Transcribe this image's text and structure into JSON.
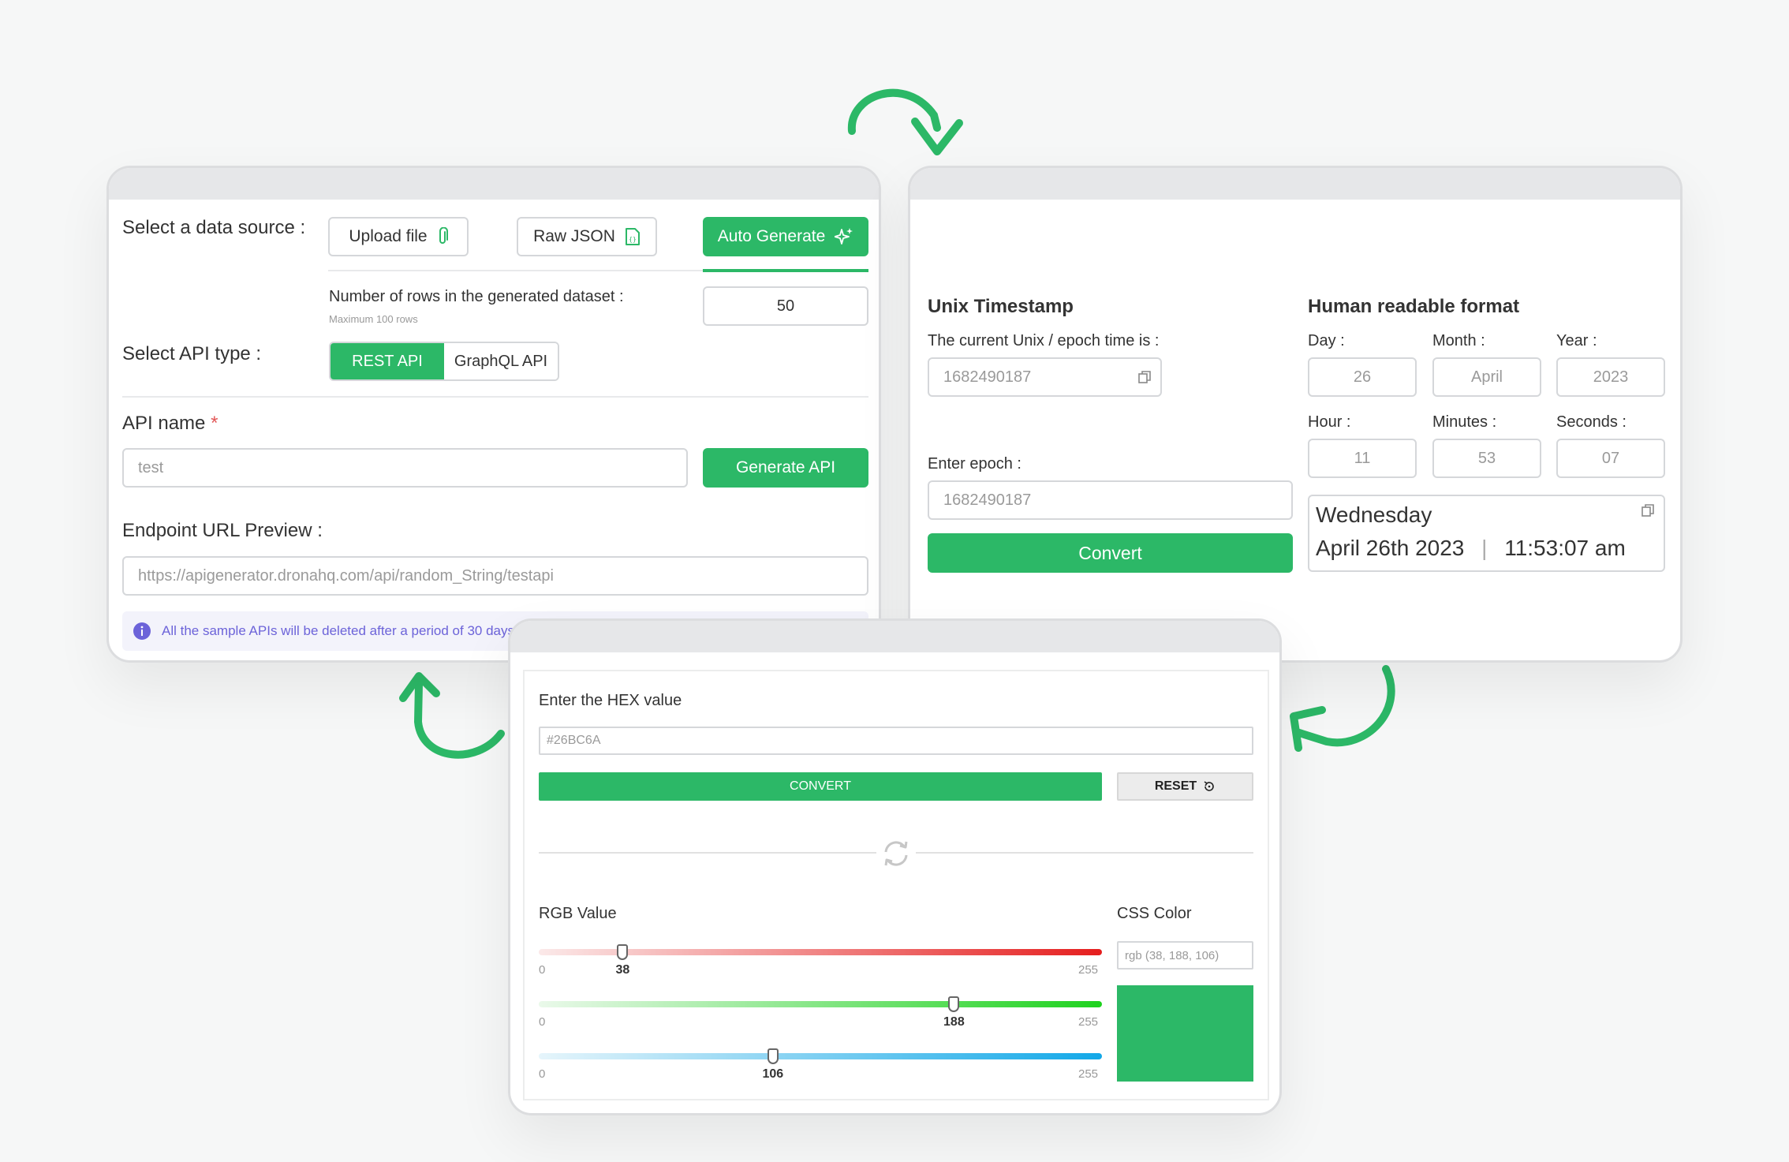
{
  "api_panel": {
    "data_source_label": "Select a data source :",
    "upload_file": "Upload file",
    "raw_json": "Raw JSON",
    "auto_generate": "Auto Generate",
    "rows_label": "Number of rows in the generated dataset :",
    "rows_hint": "Maximum 100 rows",
    "rows_value": "50",
    "api_type_label": "Select API type :",
    "rest_api": "REST API",
    "graphql_api": "GraphQL API",
    "api_name_label": "API name",
    "required_mark": "*",
    "api_name_value": "test",
    "generate_api": "Generate API",
    "endpoint_label": "Endpoint URL Preview :",
    "endpoint_value": "https://apigenerator.dronahq.com/api/random_String/testapi",
    "info_text": "All the sample APIs will be deleted after a period of 30 days"
  },
  "timestamp_panel": {
    "unix_title": "Unix Timestamp",
    "current_label": "The current Unix / epoch time is :",
    "current_value": "1682490187",
    "enter_epoch_label": "Enter epoch :",
    "enter_epoch_value": "1682490187",
    "convert": "Convert",
    "human_title": "Human readable format",
    "day_label": "Day :",
    "day_value": "26",
    "month_label": "Month :",
    "month_value": "April",
    "year_label": "Year :",
    "year_value": "2023",
    "hour_label": "Hour :",
    "hour_value": "11",
    "minutes_label": "Minutes :",
    "minutes_value": "53",
    "seconds_label": "Seconds :",
    "seconds_value": "07",
    "result_weekday": "Wednesday",
    "result_date": "April 26th 2023",
    "result_separator": "|",
    "result_time": "11:53:07 am"
  },
  "color_panel": {
    "hex_label": "Enter the HEX value",
    "hex_value": "#26BC6A",
    "convert": "CONVERT",
    "reset": "RESET",
    "rgb_label": "RGB Value",
    "css_label": "CSS Color",
    "css_value": "rgb (38, 188, 106)",
    "swatch_color": "#2cb867",
    "sliders": [
      {
        "channel": "red",
        "value": 38,
        "min": "0",
        "max": "255",
        "value_label": "38"
      },
      {
        "channel": "green",
        "value": 188,
        "min": "0",
        "max": "255",
        "value_label": "188"
      },
      {
        "channel": "blue",
        "value": 106,
        "min": "0",
        "max": "255",
        "value_label": "106"
      }
    ]
  },
  "colors": {
    "accent": "#2cb867",
    "info": "#6c63d9"
  }
}
